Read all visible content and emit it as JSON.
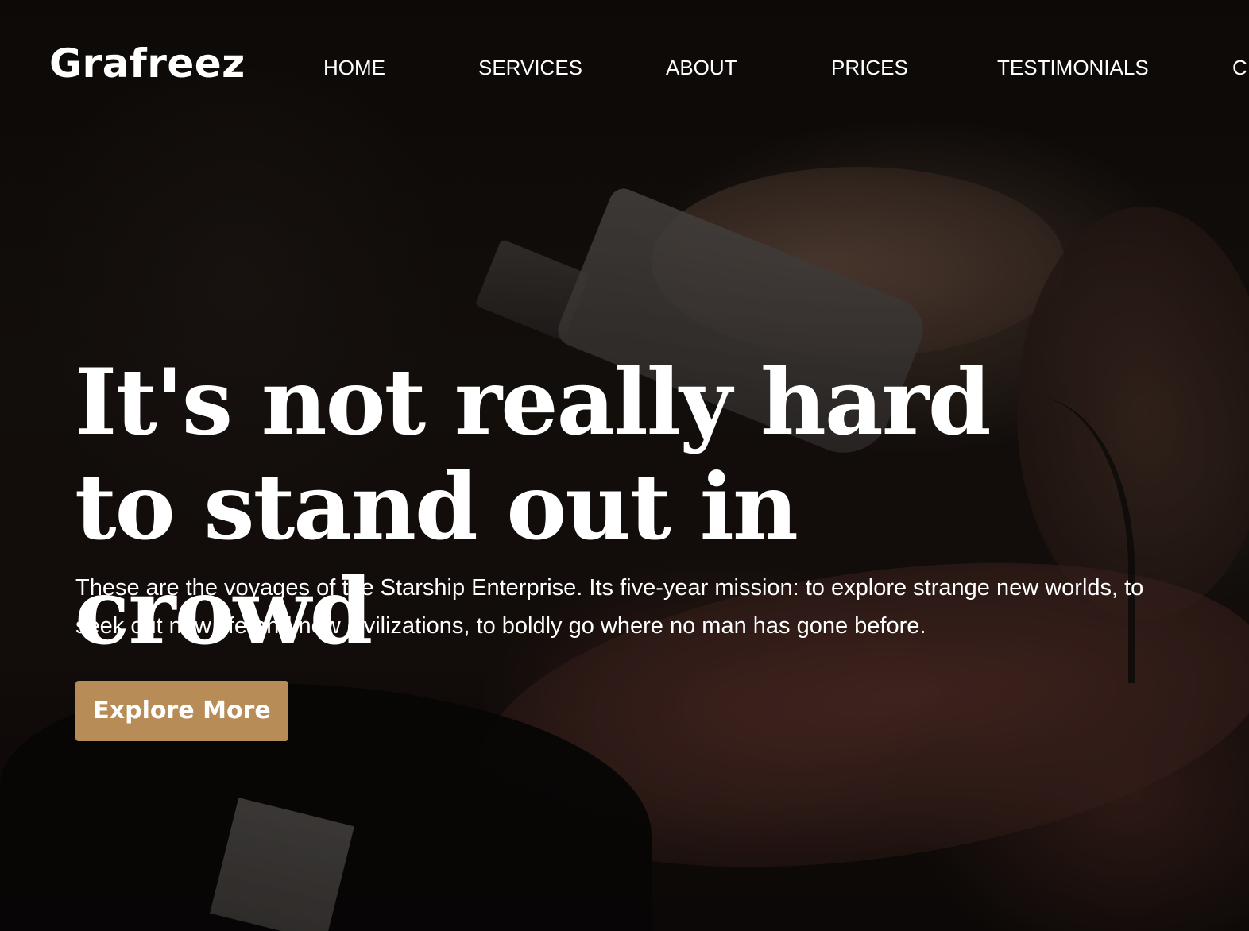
{
  "header": {
    "logo": "Grafreez",
    "nav": [
      {
        "label": "HOME"
      },
      {
        "label": "SERVICES"
      },
      {
        "label": "ABOUT"
      },
      {
        "label": "PRICES"
      },
      {
        "label": "TESTIMONIALS"
      },
      {
        "label": "C"
      }
    ]
  },
  "hero": {
    "title": "It's not really hard to stand out in crowd",
    "text": "These are the voyages of the Starship Enterprise. Its five-year mission: to explore strange new worlds, to seek out new life and new civilizations, to boldly go where no man has gone before.",
    "cta_label": "Explore More"
  },
  "colors": {
    "accent": "#b78c57",
    "text": "#ffffff"
  }
}
